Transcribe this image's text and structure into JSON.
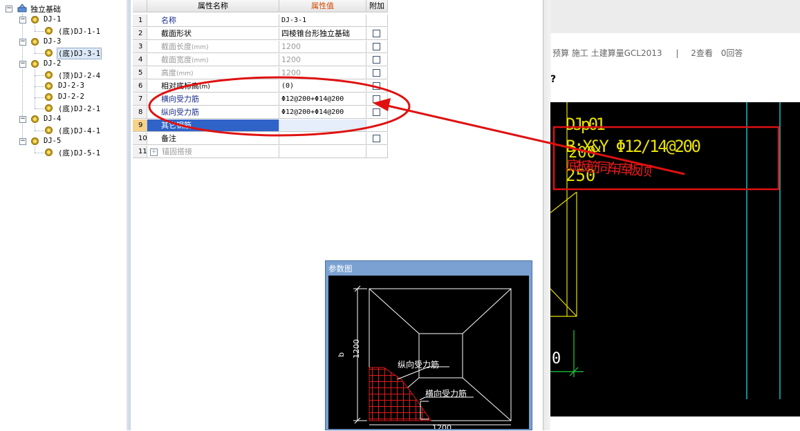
{
  "tree": {
    "root_label": "独立基础",
    "items": [
      {
        "label": "DJ-1",
        "children": [
          "(底)DJ-1-1"
        ]
      },
      {
        "label": "DJ-3",
        "children": [
          "(底)DJ-3-1"
        ]
      },
      {
        "label": "DJ-2",
        "children": [
          "(顶)DJ-2-4",
          "DJ-2-3",
          "DJ-2-2",
          "(底)DJ-2-1"
        ]
      },
      {
        "label": "DJ-4",
        "children": [
          "(底)DJ-4-1"
        ]
      },
      {
        "label": "DJ-5",
        "children": [
          "(底)DJ-5-1"
        ]
      }
    ],
    "selected": "(底)DJ-3-1"
  },
  "grid": {
    "headers": {
      "name": "属性名称",
      "value": "属性值",
      "add": "附加"
    },
    "rows": [
      {
        "num": "1",
        "name": "名称",
        "value": "DJ-3-1"
      },
      {
        "num": "2",
        "name": "截面形状",
        "value": "四棱锥台形独立基础"
      },
      {
        "num": "3",
        "name": "截面长度",
        "unit": "(mm)",
        "value": "1200"
      },
      {
        "num": "4",
        "name": "截面宽度",
        "unit": "(mm)",
        "value": "1200"
      },
      {
        "num": "5",
        "name": "高度",
        "unit": "(mm)",
        "value": "1200"
      },
      {
        "num": "6",
        "name": "相对底标高",
        "unit": "(m)",
        "value": "(0)"
      },
      {
        "num": "7",
        "name": "横向受力筋",
        "value": "Φ12@200+Φ14@200"
      },
      {
        "num": "8",
        "name": "纵向受力筋",
        "value": "Φ12@200+Φ14@200"
      },
      {
        "num": "9",
        "name": "其它钢筋",
        "value": ""
      },
      {
        "num": "10",
        "name": "备注",
        "value": ""
      },
      {
        "num": "11",
        "name": "锚固搭接",
        "value": ""
      }
    ]
  },
  "param_window": {
    "title": "参数图",
    "dim_b_letter": "b",
    "dim_b_value": "1200",
    "dim_bottom_value": "1200",
    "label_long_rebar": "纵向受力筋",
    "label_trans_rebar": "横向受力筋"
  },
  "web": {
    "breadcrumb": "预算 施工 土建算量GCL2013",
    "separator": "|",
    "views": "2查看",
    "answers": "0回答",
    "question_mark": "?"
  },
  "cad": {
    "line1": "DJp01",
    "line2": "B:X&Y Φ12/14@200",
    "line3": "200",
    "line4": "250",
    "annotation": "底板筋同车库板顶",
    "zero_mark": "0"
  },
  "colors": {
    "annotation_red": "#e01010",
    "cad_yellow": "#e8e000",
    "cad_cyan": "#14c0c8",
    "selection_blue": "#2f63c7"
  }
}
